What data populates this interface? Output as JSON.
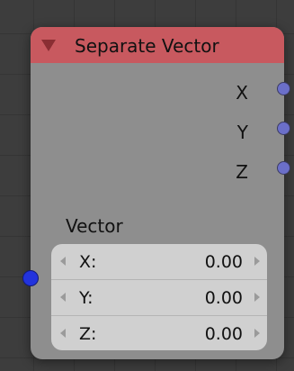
{
  "node": {
    "title": "Separate Vector",
    "header_color": "#c8595f",
    "outputs": [
      {
        "label": "X",
        "socket_color": "#6b6fc9"
      },
      {
        "label": "Y",
        "socket_color": "#6b6fc9"
      },
      {
        "label": "Z",
        "socket_color": "#6b6fc9"
      }
    ],
    "input": {
      "label": "Vector",
      "socket_color": "#2233dd",
      "fields": [
        {
          "label": "X:",
          "value": "0.00"
        },
        {
          "label": "Y:",
          "value": "0.00"
        },
        {
          "label": "Z:",
          "value": "0.00"
        }
      ]
    }
  }
}
